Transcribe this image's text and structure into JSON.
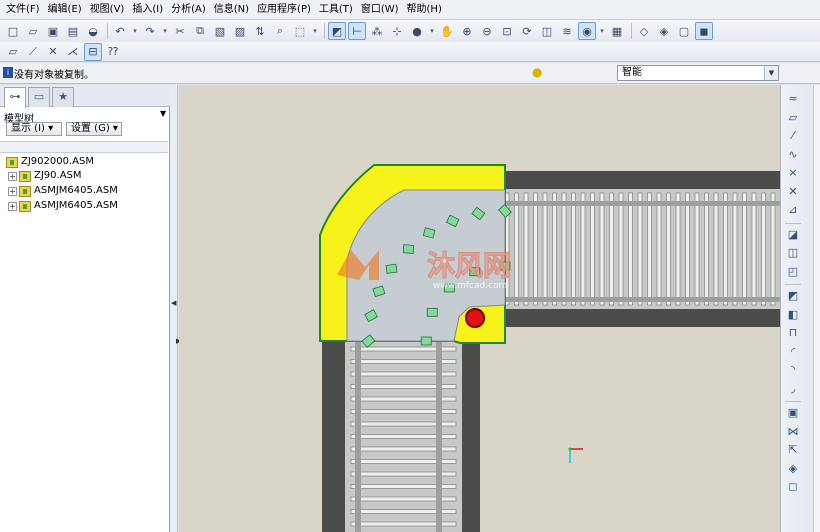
{
  "menu": [
    "文件(F)",
    "编辑(E)",
    "视图(V)",
    "插入(I)",
    "分析(A)",
    "信息(N)",
    "应用程序(P)",
    "工具(T)",
    "窗口(W)",
    "帮助(H)"
  ],
  "toolbar1": [
    {
      "name": "new-file-icon",
      "glyph": "□"
    },
    {
      "name": "open-folder-icon",
      "glyph": "▱"
    },
    {
      "name": "save-icon",
      "glyph": "▣"
    },
    {
      "name": "print-icon",
      "glyph": "▤"
    },
    {
      "name": "send-mail-icon",
      "glyph": "◒"
    },
    {
      "name": "sep"
    },
    {
      "name": "undo-icon",
      "glyph": "↶"
    },
    {
      "name": "undo-dropdown-icon",
      "glyph": "▾",
      "narrow": true
    },
    {
      "name": "redo-icon",
      "glyph": "↷"
    },
    {
      "name": "redo-dropdown-icon",
      "glyph": "▾",
      "narrow": true
    },
    {
      "name": "cut-icon",
      "glyph": "✂"
    },
    {
      "name": "copy-icon",
      "glyph": "⧉"
    },
    {
      "name": "paste-icon",
      "glyph": "▧"
    },
    {
      "name": "paste-special-icon",
      "glyph": "▨"
    },
    {
      "name": "regenerate-icon",
      "glyph": "⇅"
    },
    {
      "name": "find-icon",
      "glyph": "⌕"
    },
    {
      "name": "select-box-icon",
      "glyph": "⬚"
    },
    {
      "name": "select-dropdown-icon",
      "glyph": "▾",
      "narrow": true
    },
    {
      "name": "sep"
    },
    {
      "name": "datum-display-icon",
      "glyph": "◩",
      "active": true
    },
    {
      "name": "axis-display-icon",
      "glyph": "⊢",
      "active": true
    },
    {
      "name": "point-display-icon",
      "glyph": "⁂"
    },
    {
      "name": "csys-display-icon",
      "glyph": "⊹"
    },
    {
      "name": "shading-icon",
      "glyph": "●"
    },
    {
      "name": "shading-dropdown-icon",
      "glyph": "▾",
      "narrow": true
    },
    {
      "name": "pan-icon",
      "glyph": "✋"
    },
    {
      "name": "zoom-in-icon",
      "glyph": "⊕"
    },
    {
      "name": "zoom-out-icon",
      "glyph": "⊖"
    },
    {
      "name": "refit-icon",
      "glyph": "⊡"
    },
    {
      "name": "spin-center-icon",
      "glyph": "⟳"
    },
    {
      "name": "saved-views-icon",
      "glyph": "◫"
    },
    {
      "name": "layers-icon",
      "glyph": "≋"
    },
    {
      "name": "view-style-icon",
      "glyph": "◉",
      "active": true
    },
    {
      "name": "view-dropdown-icon",
      "glyph": "▾",
      "narrow": true
    },
    {
      "name": "view-manager-icon",
      "glyph": "▦"
    },
    {
      "name": "sep"
    },
    {
      "name": "wireframe-icon",
      "glyph": "◇"
    },
    {
      "name": "hidden-line-icon",
      "glyph": "◈"
    },
    {
      "name": "no-hidden-icon",
      "glyph": "▢"
    },
    {
      "name": "shaded-icon",
      "glyph": "◼",
      "active": true
    }
  ],
  "toolbar2": [
    {
      "name": "datum-plane-icon",
      "glyph": "▱"
    },
    {
      "name": "datum-axis-icon",
      "glyph": "⟋"
    },
    {
      "name": "datum-point-icon",
      "glyph": "✕"
    },
    {
      "name": "csys-icon",
      "glyph": "⋌"
    },
    {
      "name": "select-filter-icon",
      "glyph": "⊟",
      "active": true
    },
    {
      "name": "help-pointer-icon",
      "glyph": "⁇"
    }
  ],
  "status": {
    "message": "没有对象被复制。",
    "filter_value": "智能"
  },
  "panel": {
    "tree_title": "模型树",
    "show_button": "显示 (I) ▾",
    "settings_button": "设置 (G) ▾",
    "tree": [
      {
        "label": "ZJ902000.ASM",
        "expandable": false
      },
      {
        "label": "ZJ90.ASM",
        "expandable": true
      },
      {
        "label": "ASMJM6405.ASM",
        "expandable": true
      },
      {
        "label": "ASMJM6405.ASM",
        "expandable": true
      }
    ]
  },
  "watermark": {
    "name": "沐风网",
    "url": "www.mfcad.com"
  },
  "right_toolbar": [
    {
      "name": "sketch-tool-icon",
      "glyph": "≈"
    },
    {
      "name": "plane-tool-icon",
      "glyph": "▱"
    },
    {
      "name": "axis-tool-icon",
      "glyph": "⁄"
    },
    {
      "name": "curve-tool-icon",
      "glyph": "∿"
    },
    {
      "name": "point-tool-icon",
      "glyph": "×"
    },
    {
      "name": "csys-tool-icon",
      "glyph": "✕"
    },
    {
      "name": "analysis-tool-icon",
      "glyph": "⊿"
    },
    {
      "name": "sep"
    },
    {
      "name": "component-tool-icon",
      "glyph": "◪"
    },
    {
      "name": "assemble-tool-icon",
      "glyph": "◫"
    },
    {
      "name": "create-component-icon",
      "glyph": "◰"
    },
    {
      "name": "sep"
    },
    {
      "name": "extrude-tool-icon",
      "glyph": "◩"
    },
    {
      "name": "revolve-tool-icon",
      "glyph": "◧"
    },
    {
      "name": "hole-tool-icon",
      "glyph": "⊓"
    },
    {
      "name": "round-tool-icon",
      "glyph": "◜"
    },
    {
      "name": "chamfer-tool-icon",
      "glyph": "◝"
    },
    {
      "name": "draft-tool-icon",
      "glyph": "◞"
    },
    {
      "name": "sep"
    },
    {
      "name": "pattern-tool-icon",
      "glyph": "▣"
    },
    {
      "name": "mirror-tool-icon",
      "glyph": "⋈"
    },
    {
      "name": "move-tool-icon",
      "glyph": "⇱"
    },
    {
      "name": "merge-tool-icon",
      "glyph": "◈"
    },
    {
      "name": "trim-tool-icon",
      "glyph": "◻"
    }
  ]
}
